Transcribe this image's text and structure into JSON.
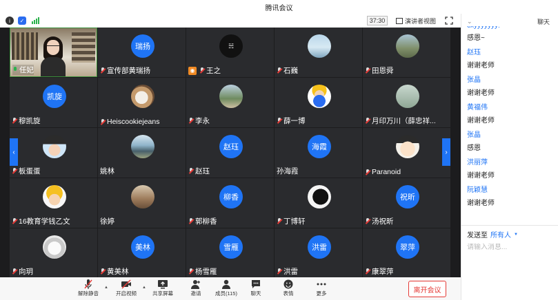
{
  "window": {
    "title": "腾讯会议"
  },
  "topbar": {
    "timer": "37:30",
    "speaker_view_label": "演讲者视图"
  },
  "participants": [
    {
      "name": "任妃",
      "avatar": "video",
      "mic": "on"
    },
    {
      "name": "宣传部黄瑞扬",
      "avatar": "瑞扬",
      "mic": "off"
    },
    {
      "name": "王之",
      "avatar": "image-calligraphy",
      "mic": "off",
      "badge": "person-icon"
    },
    {
      "name": "石巍",
      "avatar": "image-lighthouse",
      "mic": "off"
    },
    {
      "name": "田恩舜",
      "avatar": "image-landscape",
      "mic": "off"
    },
    {
      "name": "穆凯旋",
      "avatar": "凯旋",
      "mic": "off"
    },
    {
      "name": "Heiscookiejeans",
      "avatar": "image-cat",
      "mic": "off"
    },
    {
      "name": "李永",
      "avatar": "image-outdoor",
      "mic": "off"
    },
    {
      "name": "薛一博",
      "avatar": "image-cartoon-helmet",
      "mic": "off"
    },
    {
      "name": "月印万川（薛忠祥...",
      "avatar": "image-lake",
      "mic": "off"
    },
    {
      "name": "板蛋蛋",
      "avatar": "image-cartoon-boy",
      "mic": "off"
    },
    {
      "name": "姚林",
      "avatar": "image-coast",
      "mic": "none"
    },
    {
      "name": "赵珏",
      "avatar": "赵珏",
      "mic": "off"
    },
    {
      "name": "孙海霞",
      "avatar": "海霞",
      "mic": "none"
    },
    {
      "name": "Paranoid",
      "avatar": "image-cartoon-shinchan",
      "mic": "off"
    },
    {
      "name": "16教育学钱乙文",
      "avatar": "image-cartoon-naruto",
      "mic": "off"
    },
    {
      "name": "徐婷",
      "avatar": "image-portrait",
      "mic": "none"
    },
    {
      "name": "郭柳香",
      "avatar": "柳香",
      "mic": "off"
    },
    {
      "name": "丁博轩",
      "avatar": "image-black-cat",
      "mic": "off"
    },
    {
      "name": "汤祝昕",
      "avatar": "祝昕",
      "mic": "off"
    },
    {
      "name": "向玥",
      "avatar": "image-puppy",
      "mic": "off"
    },
    {
      "name": "黄美林",
      "avatar": "美林",
      "mic": "off"
    },
    {
      "name": "杨雪雁",
      "avatar": "雪雁",
      "mic": "off"
    },
    {
      "name": "洪雷",
      "avatar": "洪雷",
      "mic": "off"
    },
    {
      "name": "康翠萍",
      "avatar": "翠萍",
      "mic": "off"
    }
  ],
  "toolbar": {
    "mute_all": "解除静音",
    "video": "开启视频",
    "share": "共享屏幕",
    "invite": "邀请",
    "members": "成员(115)",
    "chat": "聊天",
    "reactions": "表情",
    "more": "更多",
    "leave": "离开会议"
  },
  "chat": {
    "title": "聊天",
    "partial_sender": "cxyyyyyyy:",
    "messages": [
      {
        "sender": "",
        "text": "感恩~"
      },
      {
        "sender": "赵珏",
        "text": "谢谢老师"
      },
      {
        "sender": "张晶",
        "text": "谢谢老师"
      },
      {
        "sender": "黄福伟",
        "text": "谢谢老师"
      },
      {
        "sender": "张晶",
        "text": "感恩"
      },
      {
        "sender": "洪丽萍",
        "text": "谢谢老师"
      },
      {
        "sender": "阮颖慧",
        "text": "谢谢老师"
      }
    ],
    "send_to_label": "发送至",
    "recipient": "所有人",
    "input_placeholder": "请输入消息..."
  },
  "colors": {
    "accent": "#1f74f5",
    "leave": "#e53935",
    "tile_bg": "#2a2b2e"
  }
}
